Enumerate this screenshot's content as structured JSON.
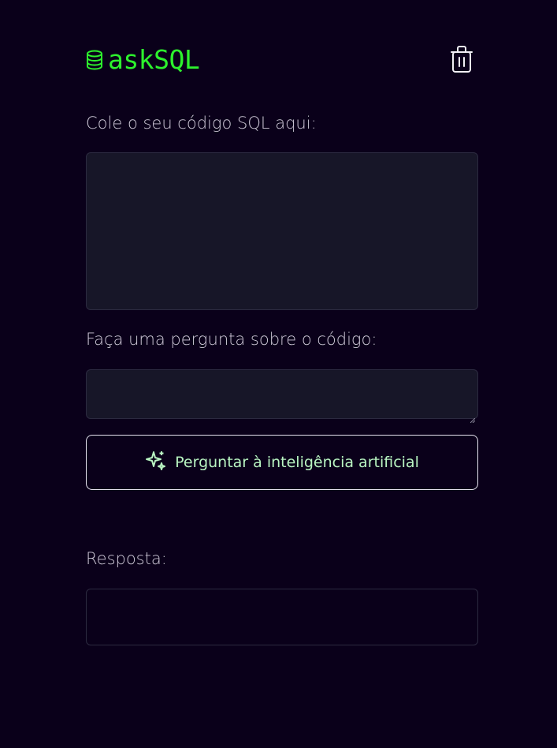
{
  "header": {
    "logo_text": "askSQL",
    "logo_icon": "database-icon",
    "trash_icon": "trash-icon"
  },
  "sql_section": {
    "label": "Cole o seu código SQL aqui:",
    "value": ""
  },
  "question_section": {
    "label": "Faça uma pergunta sobre o código:",
    "value": ""
  },
  "ask_button": {
    "label": "Perguntar à inteligência artificial",
    "icon": "sparkles-icon"
  },
  "answer_section": {
    "label": "Resposta:",
    "value": ""
  },
  "colors": {
    "background": "#0a001a",
    "brand_green": "#2df22d",
    "button_text": "#b9f5c2",
    "field_bg": "#171628"
  }
}
